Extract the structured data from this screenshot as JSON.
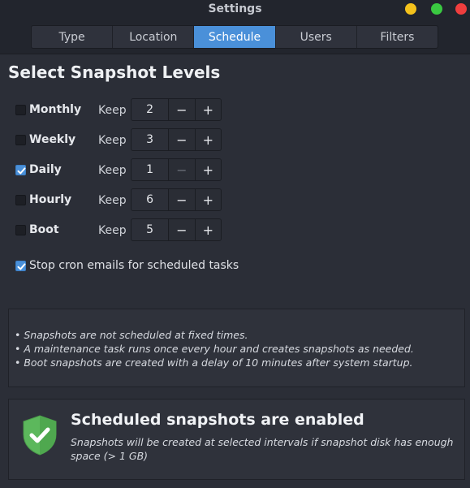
{
  "window": {
    "title": "Settings",
    "buttons": [
      {
        "name": "minimize",
        "color": "#f4c21c"
      },
      {
        "name": "maximize",
        "color": "#3ac941"
      },
      {
        "name": "close",
        "color": "#f03e3e"
      }
    ]
  },
  "tabs": [
    {
      "label": "Type",
      "active": false
    },
    {
      "label": "Location",
      "active": false
    },
    {
      "label": "Schedule",
      "active": true
    },
    {
      "label": "Users",
      "active": false
    },
    {
      "label": "Filters",
      "active": false
    }
  ],
  "section_title": "Select Snapshot Levels",
  "levels": [
    {
      "label": "Monthly",
      "checked": false,
      "keep_label": "Keep",
      "value": "2",
      "minus_enabled": true
    },
    {
      "label": "Weekly",
      "checked": false,
      "keep_label": "Keep",
      "value": "3",
      "minus_enabled": true
    },
    {
      "label": "Daily",
      "checked": true,
      "keep_label": "Keep",
      "value": "1",
      "minus_enabled": false
    },
    {
      "label": "Hourly",
      "checked": false,
      "keep_label": "Keep",
      "value": "6",
      "minus_enabled": true
    },
    {
      "label": "Boot",
      "checked": false,
      "keep_label": "Keep",
      "value": "5",
      "minus_enabled": true
    }
  ],
  "spin": {
    "minus": "−",
    "plus": "+"
  },
  "cron": {
    "label": "Stop cron emails for scheduled tasks",
    "checked": true
  },
  "info": {
    "lines": [
      "• Snapshots are not scheduled at fixed times.",
      "• A maintenance task runs once every hour and creates snapshots as needed.",
      "• Boot snapshots are created with a delay of 10 minutes after system startup."
    ]
  },
  "status": {
    "title": "Scheduled snapshots are enabled",
    "description": "Snapshots will be created at selected intervals if snapshot disk has enough space (> 1 GB)",
    "icon": "shield-check-icon",
    "icon_color": "#5cb85c"
  },
  "colors": {
    "accent": "#4a90d9",
    "background": "#2b2e37"
  }
}
